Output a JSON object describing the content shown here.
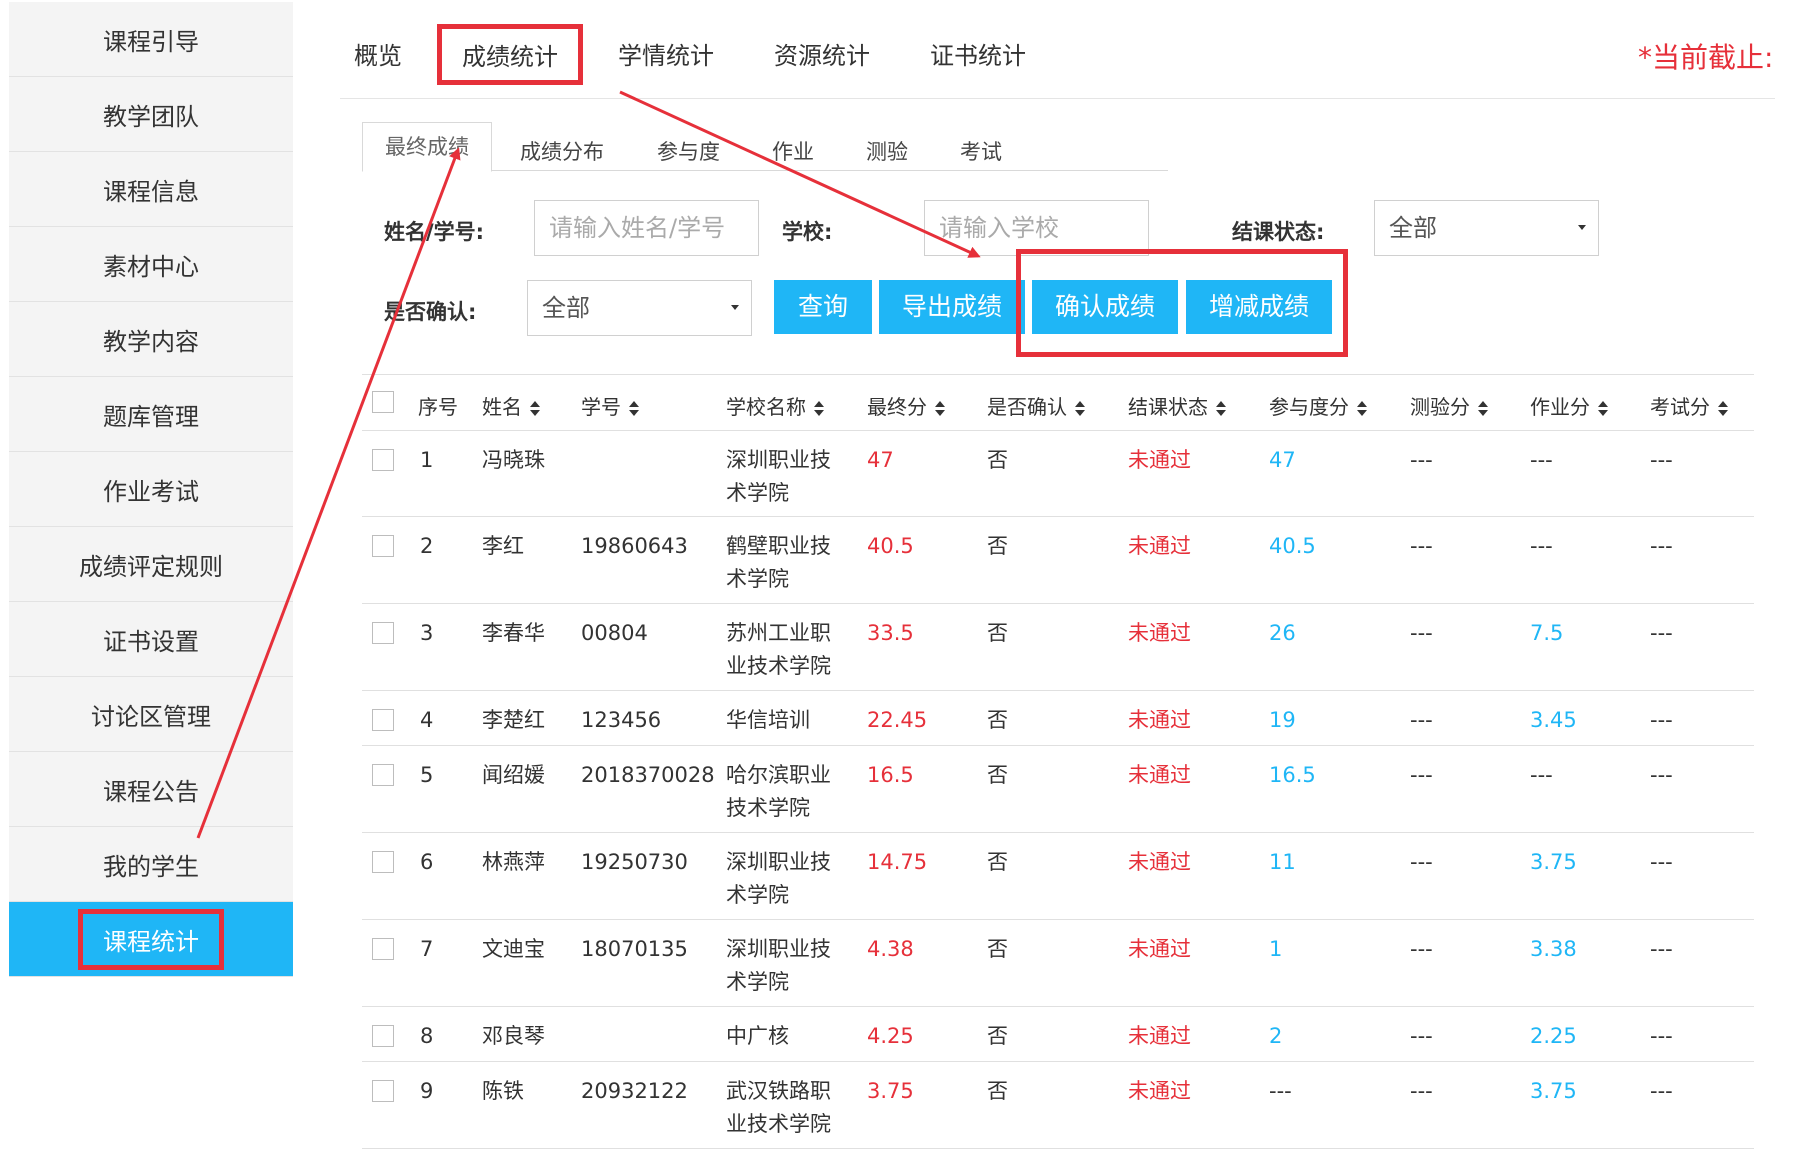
{
  "sidebar": {
    "items": [
      {
        "label": "课程引导"
      },
      {
        "label": "教学团队"
      },
      {
        "label": "课程信息"
      },
      {
        "label": "素材中心"
      },
      {
        "label": "教学内容"
      },
      {
        "label": "题库管理"
      },
      {
        "label": "作业考试"
      },
      {
        "label": "成绩评定规则"
      },
      {
        "label": "证书设置"
      },
      {
        "label": "讨论区管理"
      },
      {
        "label": "课程公告"
      },
      {
        "label": "我的学生"
      },
      {
        "label": "课程统计",
        "active": true
      }
    ]
  },
  "topnav": {
    "tabs": [
      "概览",
      "成绩统计",
      "学情统计",
      "资源统计",
      "证书统计"
    ],
    "selected": "成绩统计",
    "deadline": "*当前截止:"
  },
  "subtabs": [
    "最终成绩",
    "成绩分布",
    "参与度",
    "作业",
    "测验",
    "考试"
  ],
  "filters": {
    "name_label": "姓名/学号:",
    "name_placeholder": "请输入姓名/学号",
    "school_label": "学校:",
    "school_placeholder": "请输入学校",
    "status_label": "结课状态:",
    "status_value": "全部",
    "confirm_label": "是否确认:",
    "confirm_value": "全部"
  },
  "buttons": {
    "query": "查询",
    "export": "导出成绩",
    "confirm": "确认成绩",
    "adjust": "增减成绩"
  },
  "table": {
    "headers": [
      "序号",
      "姓名",
      "学号",
      "学校名称",
      "最终分",
      "是否确认",
      "结课状态",
      "参与度分",
      "测验分",
      "作业分",
      "考试分"
    ],
    "rows": [
      {
        "no": "1",
        "name": "冯晓珠",
        "id": "",
        "school1": "深圳职业技",
        "school2": "术学院",
        "final": "47",
        "confirmed": "否",
        "status": "未通过",
        "participation": "47",
        "quiz": "---",
        "homework": "---",
        "exam": "---"
      },
      {
        "no": "2",
        "name": "李红",
        "id": "19860643",
        "school1": "鹤壁职业技",
        "school2": "术学院",
        "final": "40.5",
        "confirmed": "否",
        "status": "未通过",
        "participation": "40.5",
        "quiz": "---",
        "homework": "---",
        "exam": "---"
      },
      {
        "no": "3",
        "name": "李春华",
        "id": "00804",
        "school1": "苏州工业职",
        "school2": "业技术学院",
        "final": "33.5",
        "confirmed": "否",
        "status": "未通过",
        "participation": "26",
        "quiz": "---",
        "homework": "7.5",
        "exam": "---"
      },
      {
        "no": "4",
        "name": "李楚红",
        "id": "123456",
        "school1": "华信培训",
        "school2": "",
        "final": "22.45",
        "confirmed": "否",
        "status": "未通过",
        "participation": "19",
        "quiz": "---",
        "homework": "3.45",
        "exam": "---"
      },
      {
        "no": "5",
        "name": "闻绍媛",
        "id": "2018370028",
        "school1": "哈尔滨职业",
        "school2": "技术学院",
        "final": "16.5",
        "confirmed": "否",
        "status": "未通过",
        "participation": "16.5",
        "quiz": "---",
        "homework": "---",
        "exam": "---"
      },
      {
        "no": "6",
        "name": "林燕萍",
        "id": "19250730",
        "school1": "深圳职业技",
        "school2": "术学院",
        "final": "14.75",
        "confirmed": "否",
        "status": "未通过",
        "participation": "11",
        "quiz": "---",
        "homework": "3.75",
        "exam": "---"
      },
      {
        "no": "7",
        "name": "文迪宝",
        "id": "18070135",
        "school1": "深圳职业技",
        "school2": "术学院",
        "final": "4.38",
        "confirmed": "否",
        "status": "未通过",
        "participation": "1",
        "quiz": "---",
        "homework": "3.38",
        "exam": "---"
      },
      {
        "no": "8",
        "name": "邓良琴",
        "id": "",
        "school1": "中广核",
        "school2": "",
        "final": "4.25",
        "confirmed": "否",
        "status": "未通过",
        "participation": "2",
        "quiz": "---",
        "homework": "2.25",
        "exam": "---"
      },
      {
        "no": "9",
        "name": "陈铁",
        "id": "20932122",
        "school1": "武汉铁路职",
        "school2": "业技术学院",
        "final": "3.75",
        "confirmed": "否",
        "status": "未通过",
        "participation": "---",
        "quiz": "---",
        "homework": "3.75",
        "exam": "---"
      }
    ]
  },
  "colors": {
    "accent": "#1fb6f6",
    "highlight": "#e6303a",
    "fail": "#e6303a",
    "score": "#1fb6f6"
  }
}
